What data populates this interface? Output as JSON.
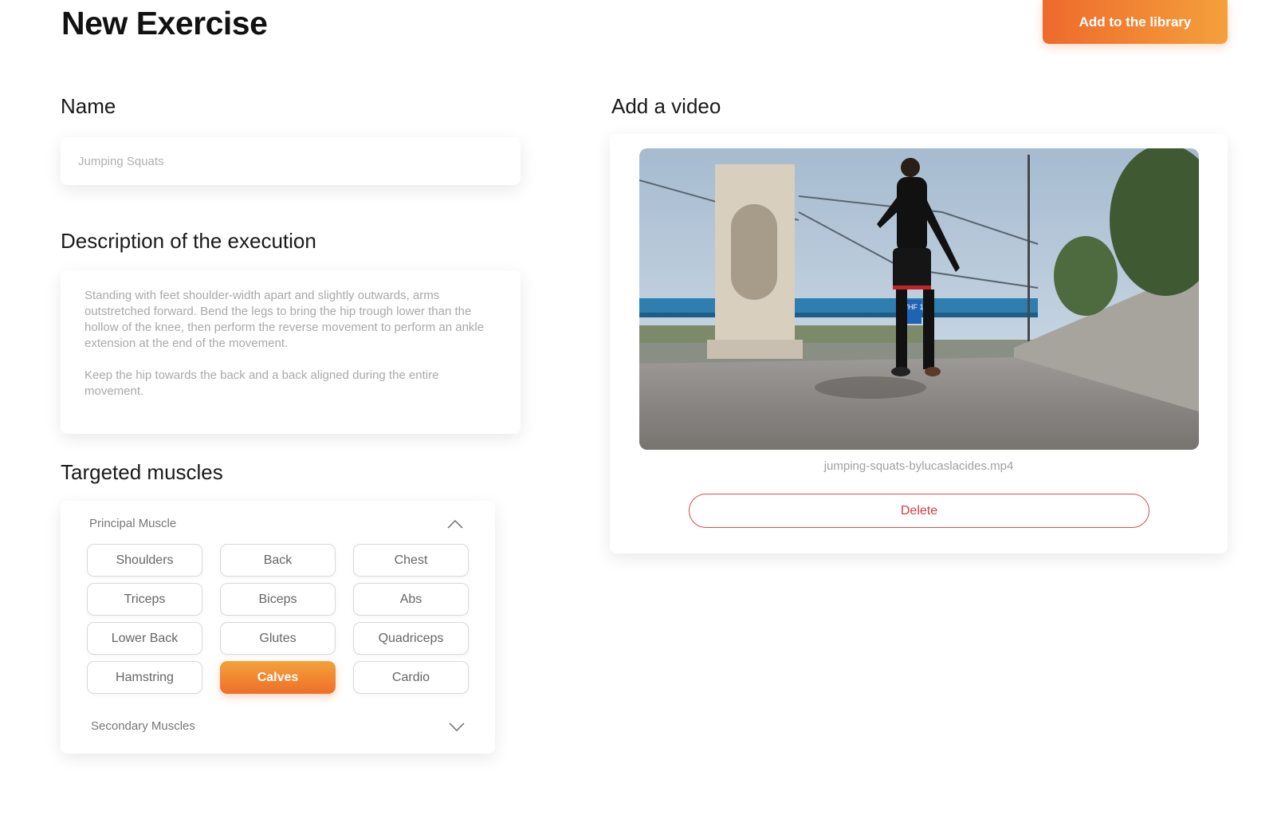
{
  "header": {
    "title": "New Exercise",
    "add_button_label": "Add to the library"
  },
  "name_section": {
    "label": "Name",
    "placeholder": "Jumping Squats"
  },
  "description_section": {
    "label": "Description of the execution",
    "paragraphs": [
      "Standing with feet shoulder-width apart and slightly outwards, arms outstretched forward. Bend the legs to bring the hip trough lower than the hollow of the knee, then perform the reverse movement to perform an ankle extension at the end of the movement.",
      "Keep the hip towards the back and a back aligned during the entire movement."
    ]
  },
  "muscles_section": {
    "label": "Targeted muscles",
    "principal_label": "Principal Muscle",
    "secondary_label": "Secondary Muscles",
    "chips": [
      {
        "label": "Shoulders",
        "selected": false
      },
      {
        "label": "Back",
        "selected": false
      },
      {
        "label": "Chest",
        "selected": false
      },
      {
        "label": "Triceps",
        "selected": false
      },
      {
        "label": "Biceps",
        "selected": false
      },
      {
        "label": "Abs",
        "selected": false
      },
      {
        "label": "Lower Back",
        "selected": false
      },
      {
        "label": "Glutes",
        "selected": false
      },
      {
        "label": "Quadriceps",
        "selected": false
      },
      {
        "label": "Hamstring",
        "selected": false
      },
      {
        "label": "Calves",
        "selected": true
      },
      {
        "label": "Cardio",
        "selected": false
      }
    ]
  },
  "video_section": {
    "label": "Add a video",
    "filename": "jumping-squats-bylucaslacides.mp4",
    "sign_text": "VHF 18",
    "delete_label": "Delete"
  },
  "colors": {
    "accent_start": "#ee6a2c",
    "accent_end": "#f4a03c",
    "danger": "#e04a4a"
  },
  "icons": {
    "principal_toggle": "chevron-up-icon",
    "secondary_toggle": "chevron-down-icon"
  }
}
